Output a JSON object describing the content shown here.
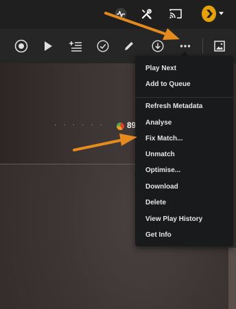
{
  "menu": {
    "items": [
      {
        "label": "Play Next"
      },
      {
        "label": "Add to Queue"
      },
      {
        "label": "Refresh Metadata"
      },
      {
        "label": "Analyse"
      },
      {
        "label": "Fix Match..."
      },
      {
        "label": "Unmatch"
      },
      {
        "label": "Optimise..."
      },
      {
        "label": "Download"
      },
      {
        "label": "Delete"
      },
      {
        "label": "View Play History"
      },
      {
        "label": "Get Info"
      }
    ]
  },
  "content": {
    "rating_partial": "89"
  },
  "colors": {
    "accent": "#e5a00d",
    "annotation_arrow": "#e58a1f",
    "menu_bg": "#191a1b",
    "topbar_bg": "#1f1f1f",
    "toolbar_bg": "#262626"
  },
  "icons": {
    "topbar": [
      "activity-icon",
      "tools-icon",
      "cast-icon",
      "user-avatar-icon",
      "caret-down-icon"
    ],
    "toolbar": [
      "record-icon",
      "play-icon",
      "add-to-queue-icon",
      "check-icon",
      "edit-icon",
      "download-icon",
      "more-icon",
      "image-icon"
    ]
  }
}
